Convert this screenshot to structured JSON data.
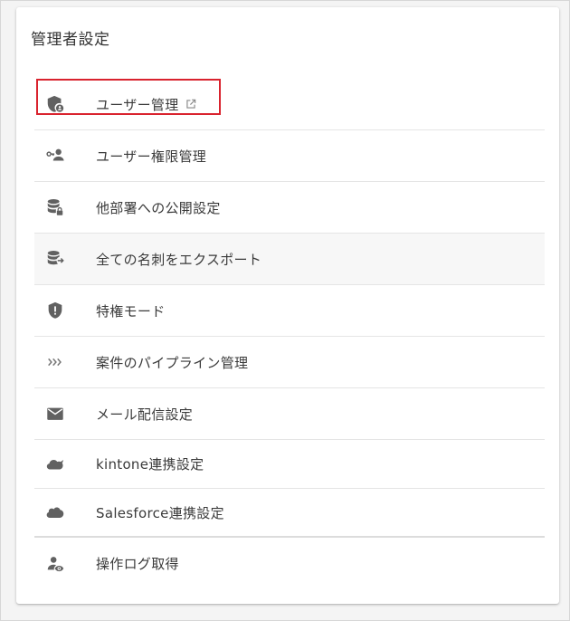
{
  "card": {
    "title": "管理者設定"
  },
  "menu": {
    "items": [
      {
        "label": "ユーザー管理",
        "icon": "shield-user-icon",
        "external": true
      },
      {
        "label": "ユーザー権限管理",
        "icon": "key-user-icon"
      },
      {
        "label": "他部署への公開設定",
        "icon": "database-lock-icon"
      },
      {
        "label": "全ての名刺をエクスポート",
        "icon": "database-export-icon"
      },
      {
        "label": "特権モード",
        "icon": "shield-alert-icon"
      },
      {
        "label": "案件のパイプライン管理",
        "icon": "chevrons-right-icon"
      },
      {
        "label": "メール配信設定",
        "icon": "mail-icon"
      },
      {
        "label": "kintone連携設定",
        "icon": "cloud-icon"
      },
      {
        "label": "Salesforce連携設定",
        "icon": "cloud-icon"
      },
      {
        "label": "操作ログ取得",
        "icon": "user-view-icon"
      }
    ]
  },
  "colors": {
    "highlight": "#d9232e",
    "icon": "#616161",
    "hover_row": "#f7f7f7"
  }
}
